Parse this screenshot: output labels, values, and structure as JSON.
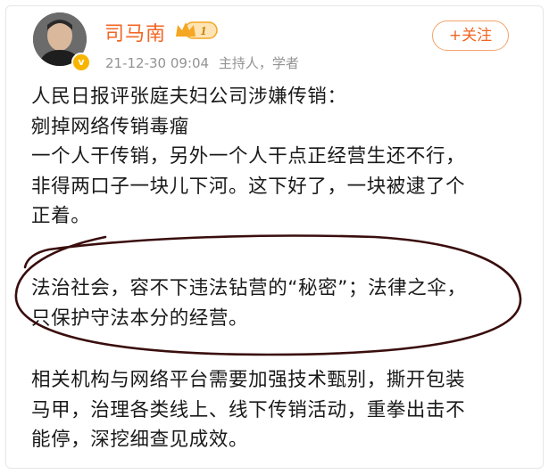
{
  "post": {
    "author": {
      "name": "司马南",
      "verified": true,
      "member_level": "1",
      "verified_mark": "v"
    },
    "meta": {
      "timestamp": "21-12-30 09:04",
      "description": "主持人，学者"
    },
    "follow_label": "+关注",
    "body": {
      "para1": [
        "人民日报评张庭夫妇公司涉嫌传销：",
        "剜掉网络传销毒瘤",
        "一个人干传销，另外一个人干点正经营生还不行，",
        "非得两口子一块儿下河。这下好了，一块被逮了个",
        "正着。"
      ],
      "para2": [
        "法治社会，容不下违法钻营的“秘密”；法律之伞，",
        "只保护守法本分的经营。"
      ],
      "para3": [
        "相关机构与网络平台需要加强技术甄别，撕开包装",
        "马甲，治理各类线上、线下传销活动，重拳出击不",
        "能停，深挖细查见成效。"
      ]
    }
  },
  "colors": {
    "username": "#f26522",
    "follow_border": "#f2a36b",
    "meta_text": "#939393",
    "member_badge": "#f5a623",
    "annotation_stroke": "#3a0d0d"
  },
  "icons": {
    "member_badge": "crown-icon",
    "verified": "verified-v-icon"
  },
  "annotation": "hand-drawn-circle"
}
